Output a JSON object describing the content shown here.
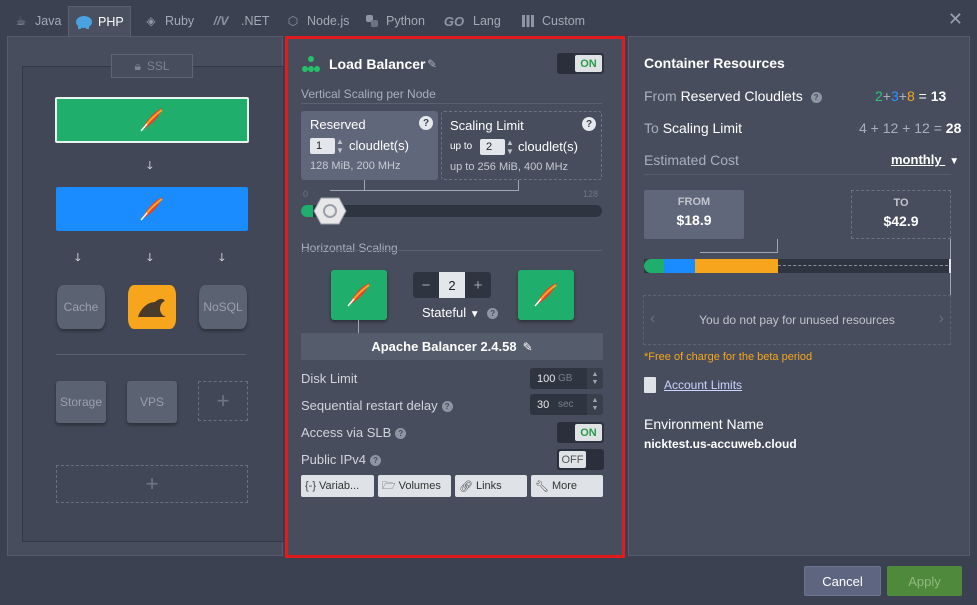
{
  "tabs": [
    {
      "label": "Java",
      "icon": "java-icon",
      "active": false
    },
    {
      "label": "PHP",
      "icon": "php-elephant-icon",
      "active": true
    },
    {
      "label": "Ruby",
      "icon": "ruby-icon",
      "active": false
    },
    {
      "label": ".NET",
      "icon": "dotnet-icon",
      "active": false
    },
    {
      "label": "Node.js",
      "icon": "nodejs-icon",
      "active": false
    },
    {
      "label": "Python",
      "icon": "python-icon",
      "active": false
    },
    {
      "label": "Lang",
      "icon": "go-icon",
      "active": false
    },
    {
      "label": "Custom",
      "icon": "custom-grid-icon",
      "active": false
    }
  ],
  "go_logo": "GO",
  "topology": {
    "ssl_label": "SSL",
    "cache_label": "Cache",
    "nosql_label": "NoSQL",
    "storage_label": "Storage",
    "vps_label": "VPS",
    "add_label": "+"
  },
  "config": {
    "title": "Load Balancer",
    "toggle_on": "ON",
    "vertical_title": "Vertical Scaling per Node",
    "reserved_label": "Reserved",
    "reserved_value": "1",
    "cloudlets_label": "cloudlet(s)",
    "reserved_info": "128 MiB, 200 MHz",
    "scaling_label": "Scaling Limit",
    "up_to": "up to",
    "scaling_value": "2",
    "scaling_info": "256 MiB, 400 MHz",
    "slider_min": "0",
    "slider_max": "128",
    "horizontal_title": "Horizontal Scaling",
    "node_count": "2",
    "minus": "−",
    "plus": "+",
    "stateful_label": "Stateful",
    "stack_name": "Apache Balancer 2.4.58",
    "disk_limit_label": "Disk Limit",
    "disk_value": "100",
    "disk_unit": "GB",
    "restart_label": "Sequential restart delay",
    "restart_value": "30",
    "restart_unit": "sec",
    "slb_label": "Access via SLB",
    "slb_toggle": "ON",
    "ipv4_label": "Public IPv4",
    "ipv4_toggle": "OFF",
    "btn_variables": "Variab...",
    "btn_volumes": "Volumes",
    "btn_links": "Links",
    "btn_more": "More"
  },
  "resources": {
    "title": "Container Resources",
    "from_label": "From",
    "reserved_cloudlets": "Reserved Cloudlets",
    "from_calc": {
      "a": "2",
      "b": "3",
      "c": "8",
      "total": "13"
    },
    "to_label": "To",
    "scaling_limit": "Scaling Limit",
    "to_calc": "4 + 12 + 12 =",
    "to_total": "28",
    "estimated_cost": "Estimated Cost",
    "period": "monthly",
    "from_box_label": "FROM",
    "from_price": "$18.9",
    "to_box_label": "TO",
    "to_price": "$42.9",
    "unused_msg": "You do not pay for unused resources",
    "free_note": "*Free of charge for the beta period",
    "account_limits": "Account Limits",
    "env_name_label": "Environment Name",
    "env_name": "nicktest.us-accuweb.cloud"
  },
  "footer": {
    "cancel": "Cancel",
    "apply": "Apply"
  },
  "colors": {
    "green": "#1fae6b",
    "blue": "#1a8cff",
    "orange": "#f7a51c",
    "highlight": "#e01b1b"
  }
}
